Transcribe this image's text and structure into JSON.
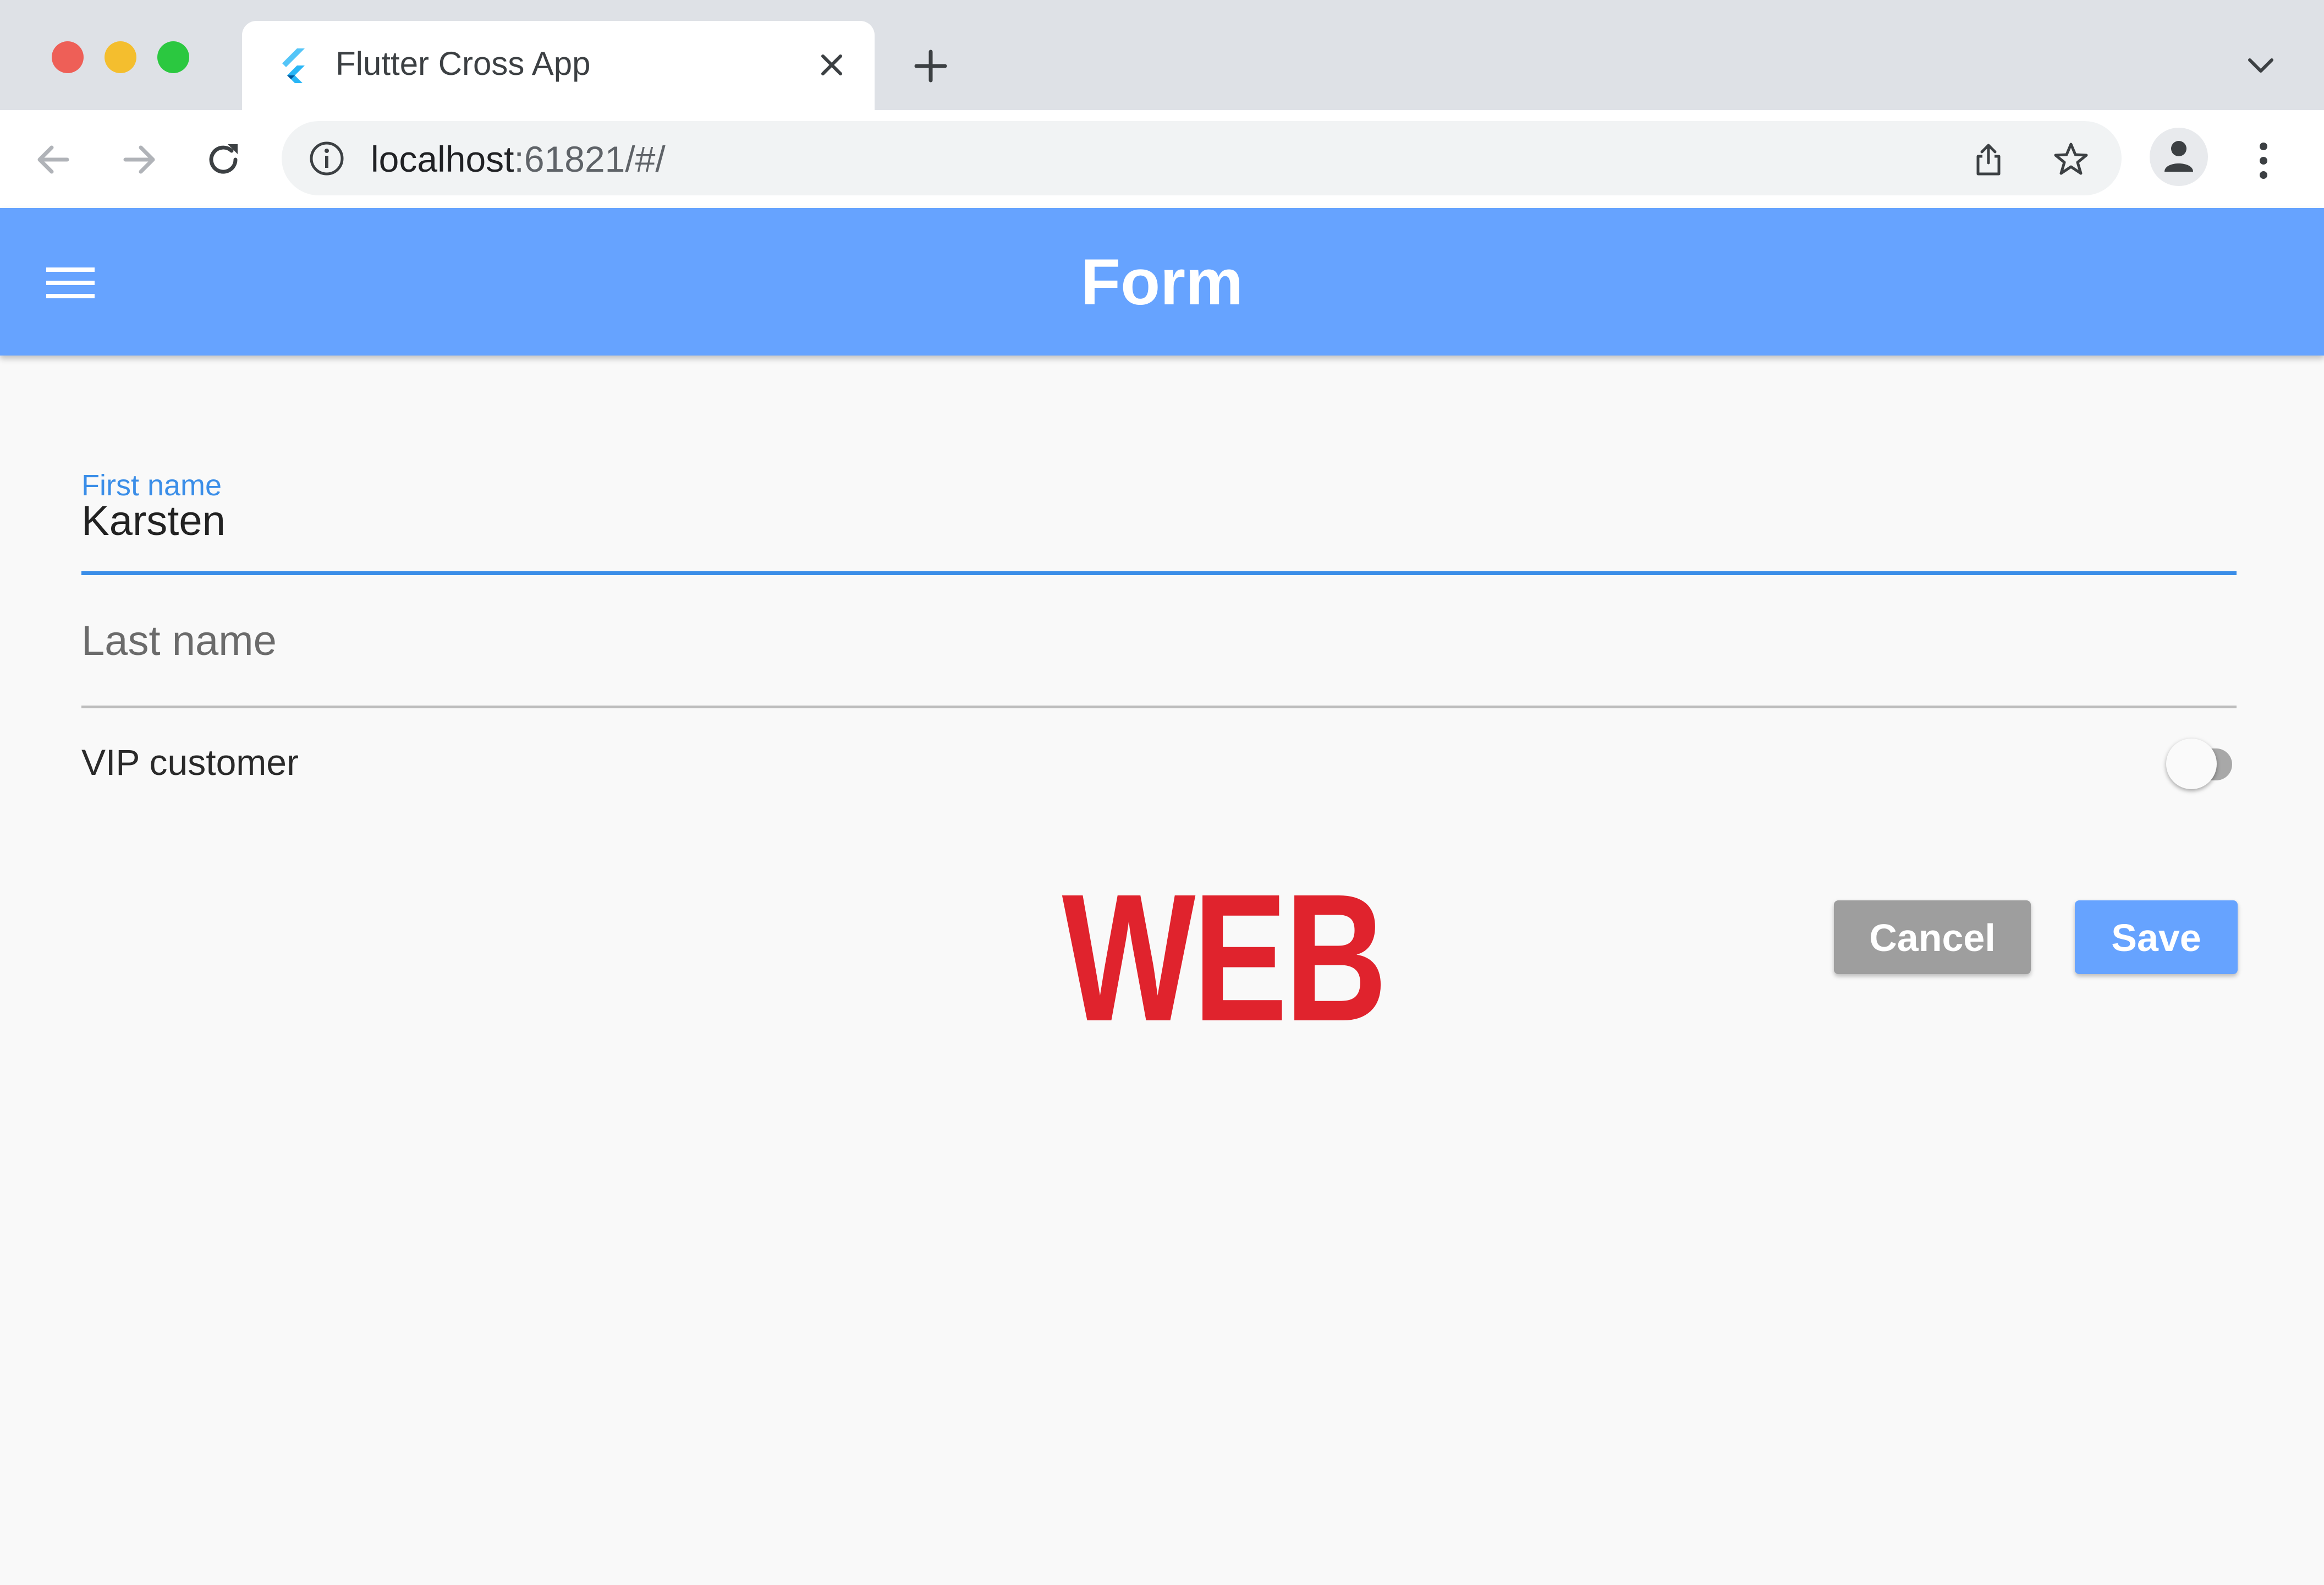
{
  "browser": {
    "tab_title": "Flutter Cross App",
    "url_host": "localhost",
    "url_rest": ":61821/#/"
  },
  "app": {
    "title": "Form",
    "accent_color": "#66a3ff"
  },
  "form": {
    "first_name": {
      "label": "First name",
      "value": "Karsten"
    },
    "last_name": {
      "placeholder": "Last name",
      "value": ""
    },
    "vip": {
      "label": "VIP customer",
      "checked": false
    }
  },
  "actions": {
    "cancel_label": "Cancel",
    "save_label": "Save"
  },
  "overlay": {
    "watermark": "WEB",
    "color": "#e0232d"
  }
}
